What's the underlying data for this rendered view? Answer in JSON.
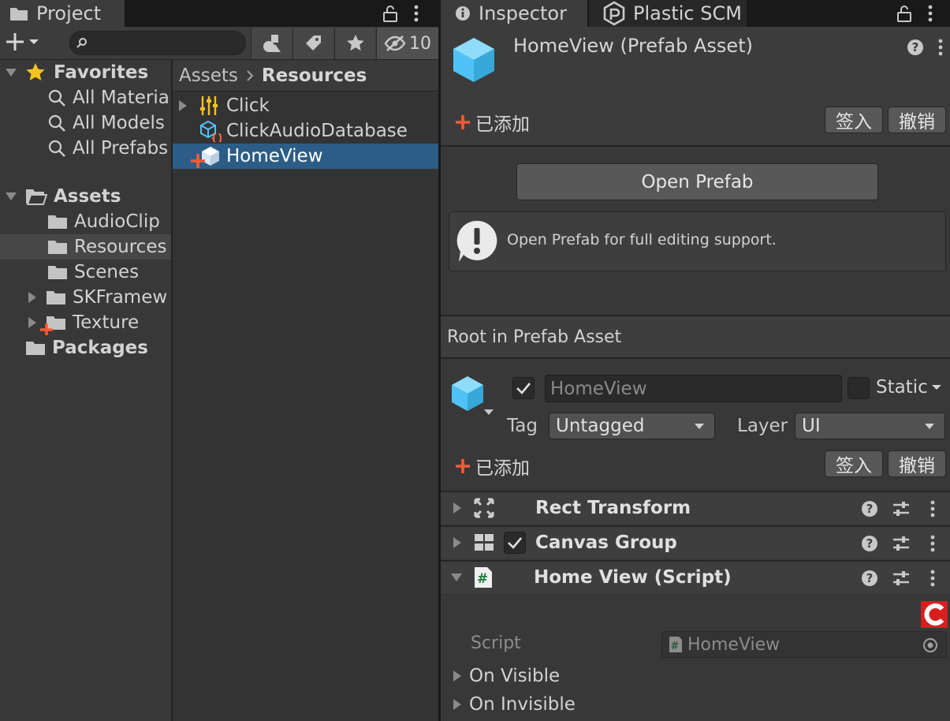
{
  "project": {
    "tab_label": "Project",
    "hidden_count": "10",
    "search_placeholder": "",
    "favorites": {
      "label": "Favorites",
      "items": [
        "All Materia",
        "All Models",
        "All Prefabs"
      ]
    },
    "assets": {
      "label": "Assets",
      "folders": [
        "AudioClip",
        "Resources",
        "Scenes",
        "SKFramew",
        "Texture"
      ]
    },
    "packages_label": "Packages",
    "breadcrumb": {
      "root": "Assets",
      "current": "Resources"
    },
    "grid_items": [
      "Click",
      "ClickAudioDatabase",
      "HomeView"
    ]
  },
  "inspector": {
    "tab_label": "Inspector",
    "plastic_tab_label": "Plastic SCM",
    "title": "HomeView (Prefab Asset)",
    "vcs_status": "已添加",
    "checkin_label": "签入",
    "revert_label": "撤销",
    "open_prefab_label": "Open Prefab",
    "info_message": "Open Prefab for full editing support.",
    "root_header": "Root in Prefab Asset",
    "go_name": "HomeView",
    "static_label": "Static",
    "tag_label": "Tag",
    "tag_value": "Untagged",
    "layer_label": "Layer",
    "layer_value": "UI",
    "components": [
      "Rect Transform",
      "Canvas Group",
      "Home View (Script)"
    ],
    "script_label": "Script",
    "script_value": "HomeView",
    "events": [
      "On Visible",
      "On Invisible"
    ]
  },
  "colors": {
    "selection": "#2c5d87",
    "vcs_added": "#ff5a32",
    "star": "#f5c31f",
    "cube": "#4fc3f7"
  }
}
